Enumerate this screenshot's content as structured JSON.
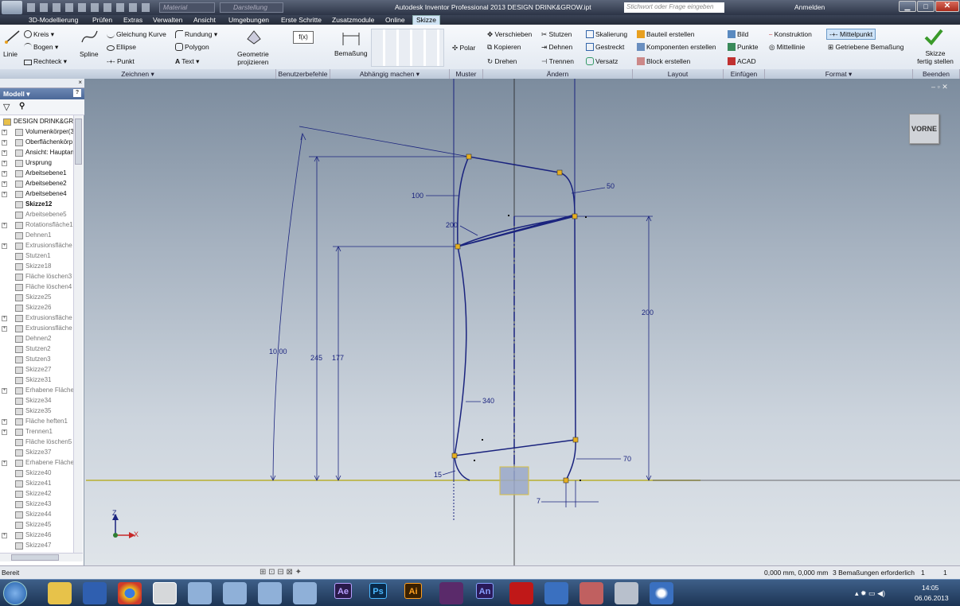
{
  "titlebar": {
    "title": "Autodesk Inventor Professional 2013 DESIGN DRINK&GROW.ipt",
    "material": "Material",
    "appearance": "Darstellung",
    "search_placeholder": "Stichwort oder Frage eingeben",
    "signin": "Anmelden"
  },
  "menu": [
    "3D-Modellierung",
    "Prüfen",
    "Extras",
    "Verwalten",
    "Ansicht",
    "Umgebungen",
    "Erste Schritte",
    "Zusatzmodule",
    "Online",
    "Skizze"
  ],
  "ribbon": {
    "zeichnen": {
      "linie": "Linie",
      "kreis": "Kreis",
      "bogen": "Bogen",
      "rechteck": "Rechteck",
      "spline": "Spline",
      "gleichung": "Gleichung Kurve",
      "ellipse": "Ellipse",
      "punkt": "Punkt",
      "rundung": "Rundung",
      "polygon": "Polygon",
      "text": "Text",
      "geometrie": "Geometrie",
      "projizieren": "projizieren",
      "label": "Zeichnen"
    },
    "benutzer": {
      "label": "Benutzerbefehle",
      "fx": "f(x)"
    },
    "abhaengig": {
      "bemassung": "Bemaßung",
      "label": "Abhängig machen"
    },
    "muster": {
      "polar": "Polar",
      "label": "Muster"
    },
    "aendern": {
      "verschieben": "Verschieben",
      "kopieren": "Kopieren",
      "drehen": "Drehen",
      "stutzen": "Stutzen",
      "dehnen": "Dehnen",
      "trennen": "Trennen",
      "skalierung": "Skalierung",
      "gestreckt": "Gestreckt",
      "versatz": "Versatz",
      "label": "Ändern"
    },
    "layout": {
      "bauteil": "Bauteil erstellen",
      "komponenten": "Komponenten erstellen",
      "block": "Block erstellen",
      "label": "Layout"
    },
    "einfuegen": {
      "bild": "Bild",
      "punkte": "Punkte",
      "acad": "ACAD",
      "label": "Einfügen"
    },
    "format": {
      "konstruktion": "Konstruktion",
      "mittelpunkt": "Mittelpunkt",
      "mittellinie": "Mittellinie",
      "getriebene": "Getriebene Bemaßung",
      "label": "Format"
    },
    "beenden": {
      "skizze": "Skizze",
      "fertig": "fertig stellen",
      "label": "Beenden"
    }
  },
  "browser": {
    "header": "Modell",
    "items": [
      {
        "label": "DESIGN DRINK&GRO",
        "exp": false,
        "dim": false,
        "bold": false
      },
      {
        "label": "Volumenkörper(3",
        "exp": true,
        "dim": false,
        "bold": false
      },
      {
        "label": "Oberflächenkörp",
        "exp": true,
        "dim": false,
        "bold": false
      },
      {
        "label": "Ansicht: Hauptan",
        "exp": true,
        "dim": false,
        "bold": false
      },
      {
        "label": "Ursprung",
        "exp": true,
        "dim": false,
        "bold": false
      },
      {
        "label": "Arbeitsebene1",
        "exp": true,
        "dim": false,
        "bold": false
      },
      {
        "label": "Arbeitsebene2",
        "exp": true,
        "dim": false,
        "bold": false
      },
      {
        "label": "Arbeitsebene4",
        "exp": true,
        "dim": false,
        "bold": false
      },
      {
        "label": "Skizze12",
        "exp": false,
        "dim": false,
        "bold": true
      },
      {
        "label": "Arbeitsebene5",
        "exp": false,
        "dim": true,
        "bold": false
      },
      {
        "label": "Rotationsfläche1",
        "exp": true,
        "dim": true,
        "bold": false
      },
      {
        "label": "Dehnen1",
        "exp": false,
        "dim": true,
        "bold": false
      },
      {
        "label": "Extrusionsfläche",
        "exp": true,
        "dim": true,
        "bold": false
      },
      {
        "label": "Stutzen1",
        "exp": false,
        "dim": true,
        "bold": false
      },
      {
        "label": "Skizze18",
        "exp": false,
        "dim": true,
        "bold": false
      },
      {
        "label": "Fläche löschen3",
        "exp": false,
        "dim": true,
        "bold": false
      },
      {
        "label": "Fläche löschen4",
        "exp": false,
        "dim": true,
        "bold": false
      },
      {
        "label": "Skizze25",
        "exp": false,
        "dim": true,
        "bold": false
      },
      {
        "label": "Skizze26",
        "exp": false,
        "dim": true,
        "bold": false
      },
      {
        "label": "Extrusionsfläche",
        "exp": true,
        "dim": true,
        "bold": false
      },
      {
        "label": "Extrusionsfläche",
        "exp": true,
        "dim": true,
        "bold": false
      },
      {
        "label": "Dehnen2",
        "exp": false,
        "dim": true,
        "bold": false
      },
      {
        "label": "Stutzen2",
        "exp": false,
        "dim": true,
        "bold": false
      },
      {
        "label": "Stutzen3",
        "exp": false,
        "dim": true,
        "bold": false
      },
      {
        "label": "Skizze27",
        "exp": false,
        "dim": true,
        "bold": false
      },
      {
        "label": "Skizze31",
        "exp": false,
        "dim": true,
        "bold": false
      },
      {
        "label": "Erhabene Fläche",
        "exp": true,
        "dim": true,
        "bold": false
      },
      {
        "label": "Skizze34",
        "exp": false,
        "dim": true,
        "bold": false
      },
      {
        "label": "Skizze35",
        "exp": false,
        "dim": true,
        "bold": false
      },
      {
        "label": "Fläche heften1",
        "exp": true,
        "dim": true,
        "bold": false
      },
      {
        "label": "Trennen1",
        "exp": true,
        "dim": true,
        "bold": false
      },
      {
        "label": "Fläche löschen5",
        "exp": false,
        "dim": true,
        "bold": false
      },
      {
        "label": "Skizze37",
        "exp": false,
        "dim": true,
        "bold": false
      },
      {
        "label": "Erhabene Fläche",
        "exp": true,
        "dim": true,
        "bold": false
      },
      {
        "label": "Skizze40",
        "exp": false,
        "dim": true,
        "bold": false
      },
      {
        "label": "Skizze41",
        "exp": false,
        "dim": true,
        "bold": false
      },
      {
        "label": "Skizze42",
        "exp": false,
        "dim": true,
        "bold": false
      },
      {
        "label": "Skizze43",
        "exp": false,
        "dim": true,
        "bold": false
      },
      {
        "label": "Skizze44",
        "exp": false,
        "dim": true,
        "bold": false
      },
      {
        "label": "Skizze45",
        "exp": false,
        "dim": true,
        "bold": false
      },
      {
        "label": "Skizze46",
        "exp": true,
        "dim": true,
        "bold": false
      },
      {
        "label": "Skizze47",
        "exp": false,
        "dim": true,
        "bold": false
      }
    ]
  },
  "viewcube": "VORNE",
  "dims": {
    "d100": "100",
    "d50": "50",
    "d200a": "200",
    "d200b": "200",
    "d1000": "10,00",
    "d245": "245",
    "d177": "177",
    "d340": "340",
    "d15": "15",
    "d70": "70",
    "d7": "7"
  },
  "axes": {
    "x": "X",
    "z": "Z"
  },
  "status": {
    "left": "Bereit",
    "coords": "0,000 mm, 0,000 mm",
    "constraints": "3 Bemaßungen erforderlich",
    "n1": "1",
    "n2": "1"
  },
  "taskbar": {
    "time": "14:05",
    "date": "06.06.2013",
    "apps": [
      "Ae",
      "Ps",
      "Ai",
      "An"
    ]
  }
}
